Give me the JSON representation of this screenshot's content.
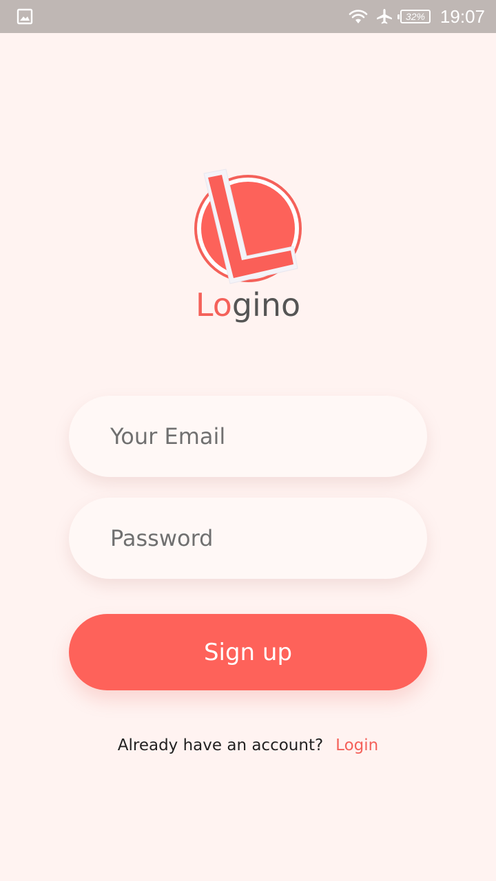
{
  "status_bar": {
    "gallery_icon": "image-icon",
    "wifi_icon": "wifi-icon",
    "airplane_icon": "airplane-icon",
    "battery_percent": "32%",
    "time": "19:07"
  },
  "brand": {
    "logo_icon": "logino-logo-icon",
    "name_accent": "Lo",
    "name_rest": "gino",
    "accent_color": "#f4615a"
  },
  "form": {
    "email_placeholder": "Your Email",
    "email_value": "",
    "password_placeholder": "Password",
    "password_value": "",
    "signup_label": "Sign up",
    "button_color": "#fe625a"
  },
  "footer": {
    "question": "Already have an account?",
    "login_link": "Login"
  }
}
